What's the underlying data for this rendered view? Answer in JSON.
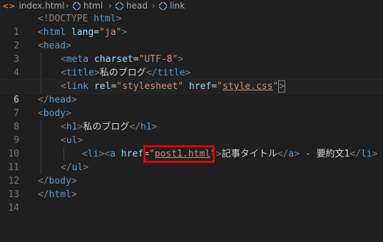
{
  "breadcrumb": {
    "file": "index.html",
    "file_icon": "html5-icon",
    "items": [
      "html",
      "head",
      "link"
    ],
    "item_icon": "element-icon"
  },
  "editor": {
    "current_line": 6,
    "lines": [
      {
        "num": "1"
      },
      {
        "num": "2"
      },
      {
        "num": "3"
      },
      {
        "num": "4"
      },
      {
        "num": "5"
      },
      {
        "num": "6"
      },
      {
        "num": "7"
      },
      {
        "num": "8"
      },
      {
        "num": "9"
      },
      {
        "num": "10"
      },
      {
        "num": "11"
      },
      {
        "num": "12"
      },
      {
        "num": "13"
      },
      {
        "num": "14"
      }
    ],
    "tokens": {
      "l1_doctype": "<!DOCTYPE",
      "l1_html": " html",
      "html": "html",
      "lang": "lang",
      "lang_val": "\"ja\"",
      "head": "head",
      "meta": "meta",
      "charset": "charset",
      "charset_val": "\"UTF-8\"",
      "title": "title",
      "title_text": "私のブログ",
      "link": "link",
      "rel": "rel",
      "rel_val": "\"stylesheet\"",
      "href": "href",
      "href_val_q1": "\"",
      "href_val": "style.css",
      "href_val_q2": "\"",
      "body": "body",
      "h1": "h1",
      "h1_text": "私のブログ",
      "ul": "ul",
      "li": "li",
      "a": "a",
      "a_href": "href",
      "a_href_q1": "\"",
      "a_href_val": "post1.html",
      "a_href_q2": "\"",
      "a_text": "記事タイトル",
      "li_text": " - 要約文1"
    }
  },
  "colors": {
    "background": "#1f1f1f",
    "highlight_box": "#e00000",
    "tag": "#569cd6",
    "attribute": "#9cdcfe",
    "string": "#ce9178"
  }
}
